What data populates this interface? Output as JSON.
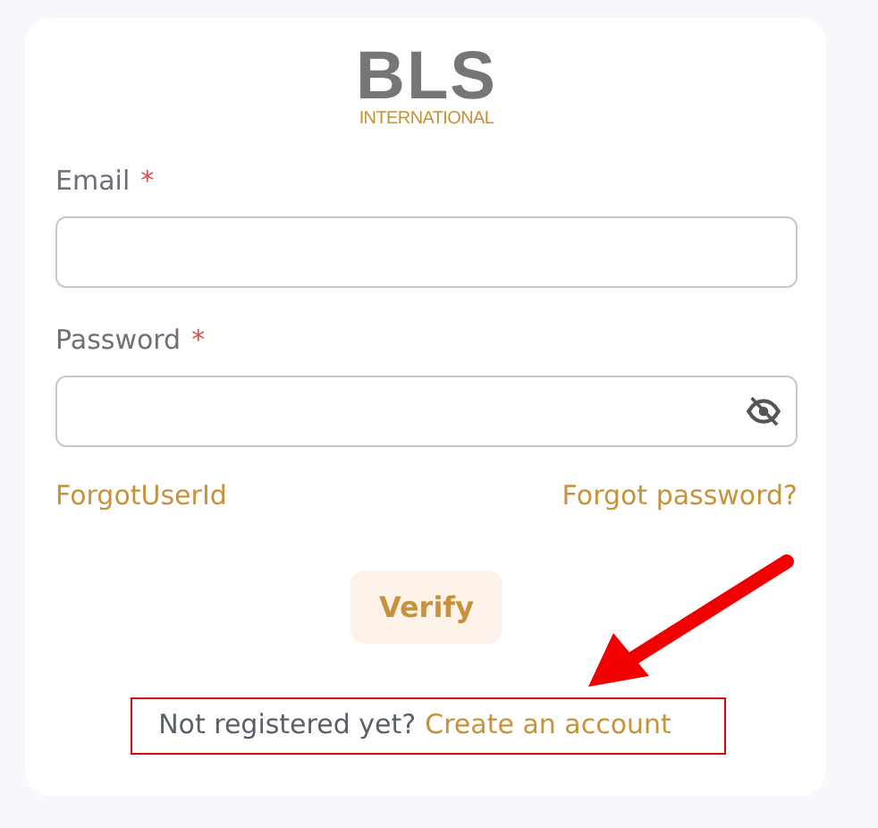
{
  "logo": {
    "name": "BLS",
    "tagline": "INTERNATIONAL"
  },
  "fields": [
    {
      "label": "Email",
      "required": true,
      "required_mark": "*",
      "kind": "text"
    },
    {
      "label": "Password",
      "required": true,
      "required_mark": "*",
      "kind": "password"
    }
  ],
  "links": [
    "ForgotUserId",
    "Forgot password?"
  ],
  "submit_button": "Verify",
  "signup": {
    "prompt": "Not registered yet?",
    "link": "Create an account"
  },
  "annotation": {
    "highlight": true,
    "arrow": true
  }
}
